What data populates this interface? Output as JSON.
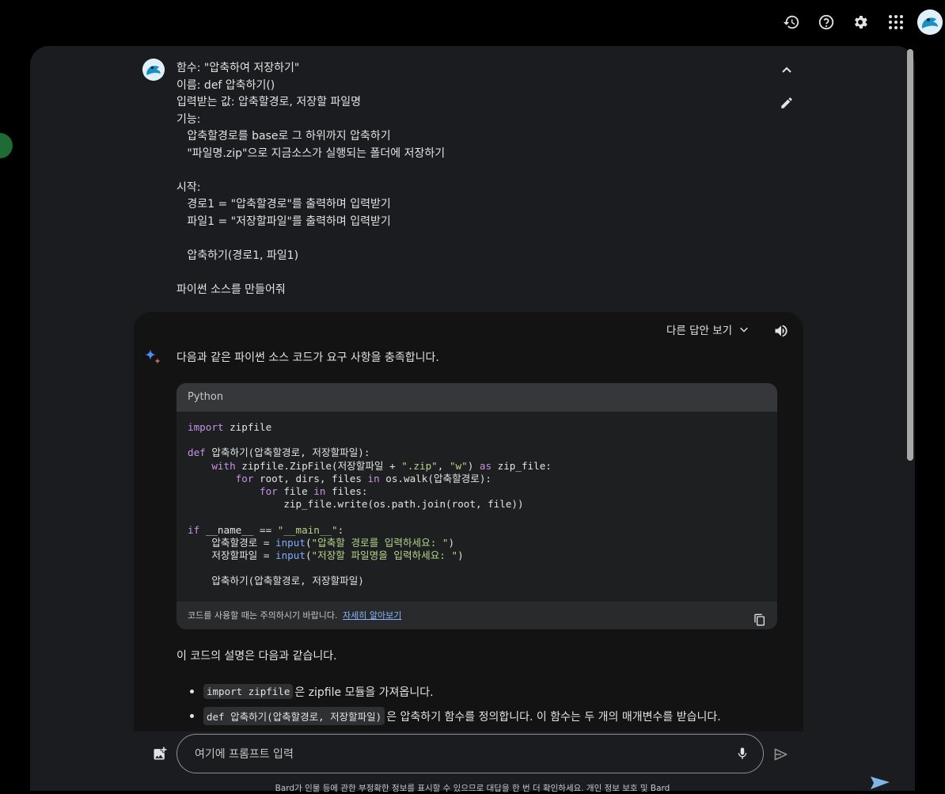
{
  "top_icons": [
    "history-icon",
    "help-icon",
    "settings-icon",
    "apps-grid-icon"
  ],
  "prompt_lines": [
    "함수: \"압축하여 저장하기\"",
    "이름: def 압축하기()",
    "입력받는 값: 압축할경로, 저장할 파일명",
    "기능:",
    "   압축할경로를 base로 그 하위까지 압축하기",
    "   \"파일명.zip\"으로 지금소스가 실행되는 폴더에 저장하기",
    "",
    "시작:",
    "   경로1 = \"압축할경로\"를 출력하며 입력받기",
    "   파일1 = \"저장할파일\"를 출력하며 입력받기",
    "",
    "   압축하기(경로1, 파일1)",
    "",
    "파이썬 소스를 만들어줘"
  ],
  "response": {
    "drafts_label": "다른 답안 보기",
    "intro": "다음과 같은 파이썬 소스 코드가 요구 사항을 충족합니다.",
    "code_language": "Python",
    "code_footer_text": "코드를 사용할 때는 주의하시기 바랍니다.",
    "code_footer_link": "자세히 알아보기",
    "explanation_intro": "이 코드의 설명은 다음과 같습니다.",
    "bullets": [
      {
        "code": "import zipfile",
        "text": "은 zipfile 모듈을 가져옵니다."
      },
      {
        "code": "def 압축하기(압축할경로, 저장할파일)",
        "text": "은 압축하기 함수를 정의합니다. 이 함수는 두 개의 매개변수를 받습니다."
      }
    ]
  },
  "input": {
    "placeholder": "여기에 프롬프트 입력"
  },
  "disclaimer": "Bard가 인물 등에 관한 부정확한 정보를 표시할 수 있으므로 대답을 한 번 더 확인하세요. 개인 정보 보호 및 Bard"
}
